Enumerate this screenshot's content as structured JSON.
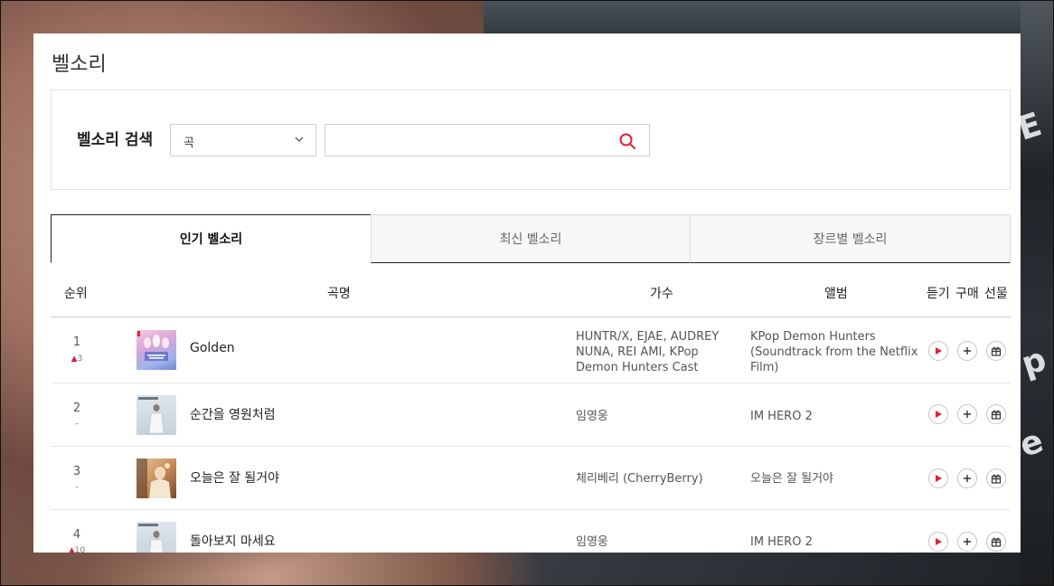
{
  "page": {
    "title": "벨소리"
  },
  "search": {
    "label": "벨소리 검색",
    "select_value": "곡",
    "input_value": "",
    "input_placeholder": ""
  },
  "tabs": [
    {
      "label": "인기 벨소리",
      "active": true
    },
    {
      "label": "최신 벨소리",
      "active": false
    },
    {
      "label": "장르별 벨소리",
      "active": false
    }
  ],
  "table": {
    "headers": {
      "rank": "순위",
      "song": "곡명",
      "artist": "가수",
      "album": "앨범",
      "listen": "듣기",
      "buy": "구매",
      "gift": "선물"
    },
    "rows": [
      {
        "rank": "1",
        "change": "3",
        "change_dir": "up",
        "title": "Golden",
        "artist": "HUNTR/X, EJAE, AUDREY NUNA, REI AMI, KPop Demon Hunters Cast",
        "album": "KPop Demon Hunters (Soundtrack from the Netflix Film)"
      },
      {
        "rank": "2",
        "change": "–",
        "change_dir": "same",
        "title": "순간을 영원처럼",
        "artist": "임영웅",
        "album": "IM HERO 2"
      },
      {
        "rank": "3",
        "change": "–",
        "change_dir": "same",
        "title": "오늘은 잘 될거야",
        "artist": "체리베리 (CherryBerry)",
        "album": "오늘은 잘 될거야"
      },
      {
        "rank": "4",
        "change": "10",
        "change_dir": "up",
        "title": "돌아보지 마세요",
        "artist": "임영웅",
        "album": "IM HERO 2"
      }
    ]
  },
  "colors": {
    "accent": "#e0213a",
    "border": "#cfcfcf",
    "text": "#222222"
  },
  "icons": {
    "search": "search-icon",
    "dropdown": "chevron-down-icon",
    "play": "play-icon",
    "add": "plus-icon",
    "gift": "gift-icon"
  }
}
